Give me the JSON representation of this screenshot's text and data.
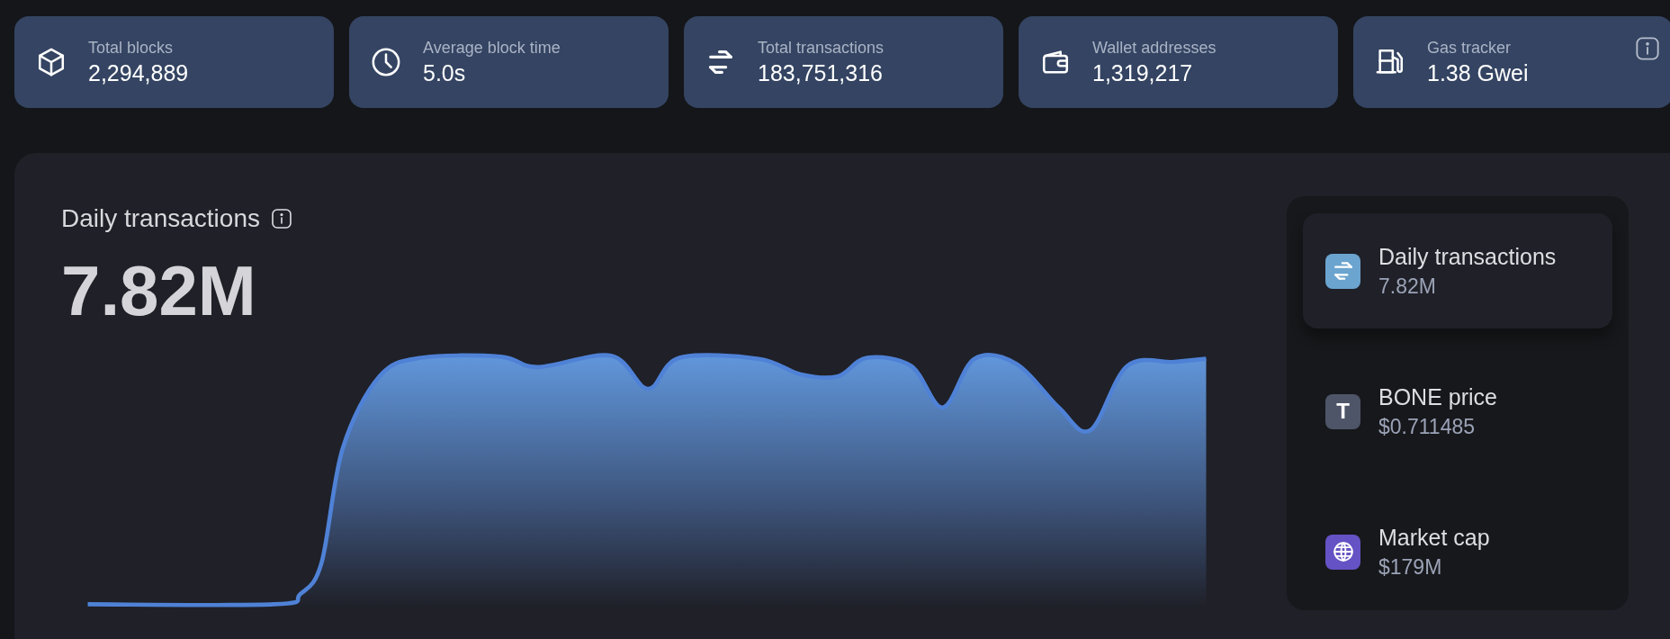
{
  "stats": [
    {
      "kind": "cube",
      "label": "Total blocks",
      "value": "2,294,889",
      "info": false
    },
    {
      "kind": "clock",
      "label": "Average block time",
      "value": "5.0s",
      "info": false
    },
    {
      "kind": "arrows",
      "label": "Total transactions",
      "value": "183,751,316",
      "info": false
    },
    {
      "kind": "wallet",
      "label": "Wallet addresses",
      "value": "1,319,217",
      "info": false
    },
    {
      "kind": "pump",
      "label": "Gas tracker",
      "value": "1.38 Gwei",
      "info": true
    }
  ],
  "chart_panel": {
    "title": "Daily transactions",
    "value": "7.82M"
  },
  "metrics": [
    {
      "kind": "arrows",
      "label": "Daily transactions",
      "value": "7.82M",
      "color": "#6ba4cf",
      "selected": true
    },
    {
      "kind": "letter",
      "glyph": "T",
      "label": "BONE price",
      "value": "$0.711485",
      "color": "#4e5568",
      "selected": false
    },
    {
      "kind": "globe",
      "label": "Market cap",
      "value": "$179M",
      "color": "#6552c4",
      "selected": false
    }
  ]
}
